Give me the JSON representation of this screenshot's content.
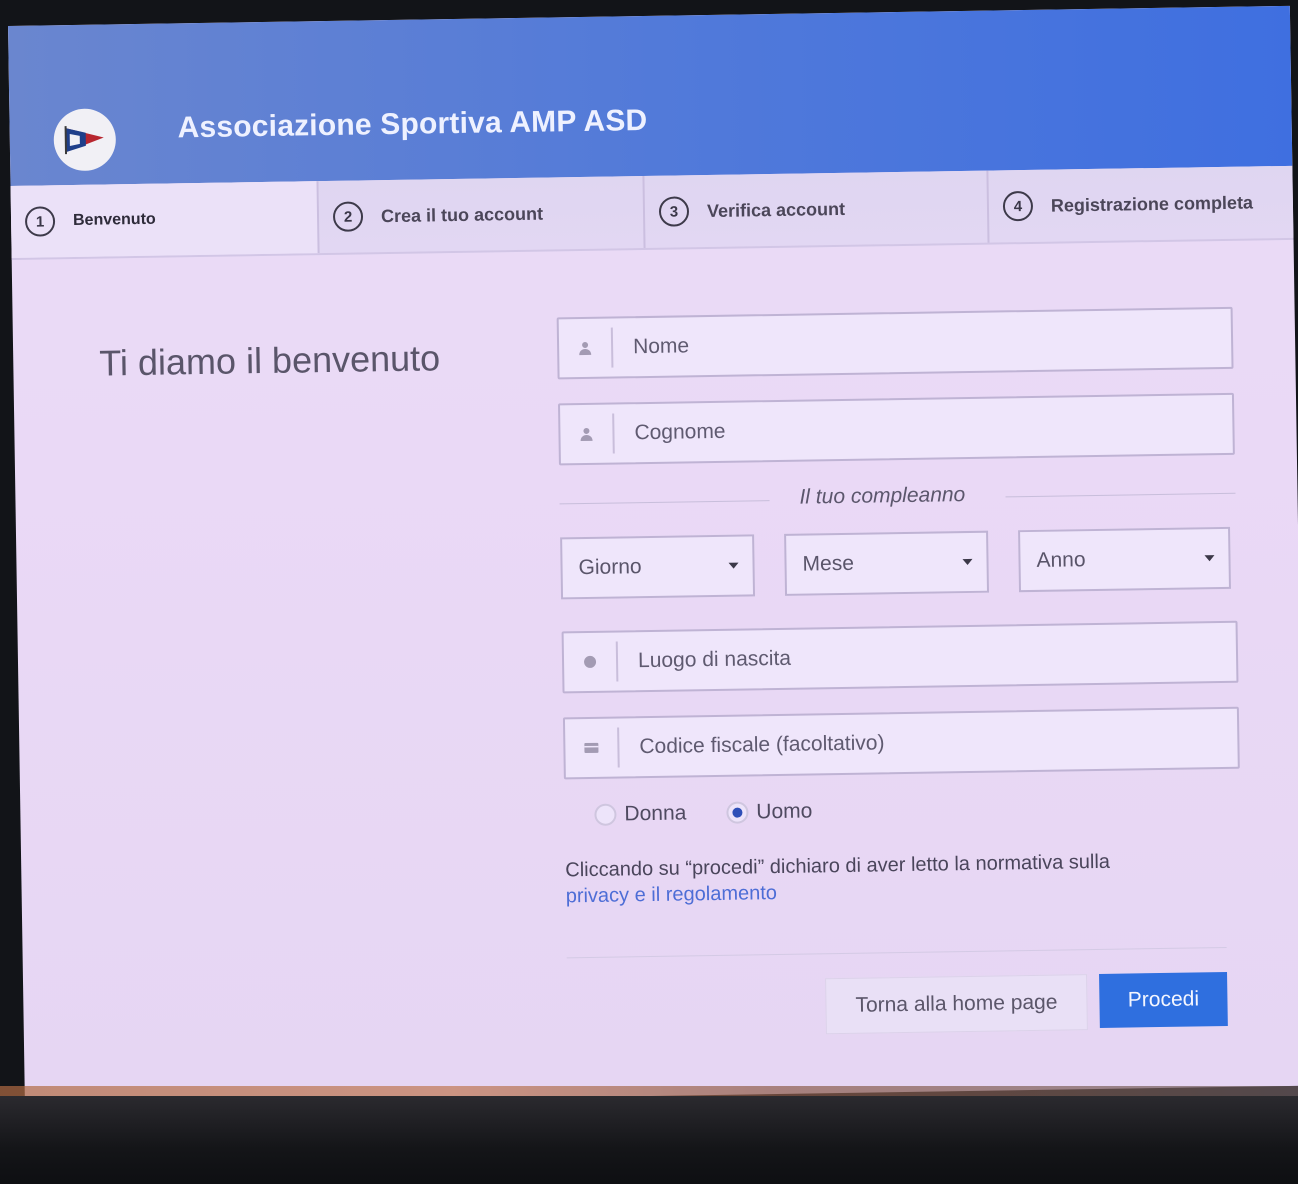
{
  "header": {
    "title": "Associazione Sportiva AMP ASD",
    "logo_icon": "pennant-logo-icon"
  },
  "steps": [
    {
      "number": "1",
      "label": "Benvenuto"
    },
    {
      "number": "2",
      "label": "Crea il tuo account"
    },
    {
      "number": "3",
      "label": "Verifica account"
    },
    {
      "number": "4",
      "label": "Registrazione completa"
    }
  ],
  "main": {
    "welcome_title": "Ti diamo il benvenuto"
  },
  "form": {
    "nome_placeholder": "Nome",
    "cognome_placeholder": "Cognome",
    "birthday_label": "Il tuo compleanno",
    "giorno_select": "Giorno",
    "mese_select": "Mese",
    "anno_select": "Anno",
    "luogo_placeholder": "Luogo di nascita",
    "codice_placeholder": "Codice fiscale (facoltativo)",
    "gender_options": [
      {
        "label": "Donna",
        "selected": false
      },
      {
        "label": "Uomo",
        "selected": true
      }
    ],
    "consent_text": "Cliccando su “procedi” dichiaro di aver letto la normativa sulla",
    "consent_link_privacy": "privacy",
    "consent_and": "e il",
    "consent_link_rules": "regolamento"
  },
  "actions": {
    "home_label": "Torna alla home page",
    "proceed_label": "Procedi"
  },
  "colors": {
    "header": "#4f78da",
    "primary_button": "#2f6fdf",
    "link": "#4d6dd6"
  }
}
